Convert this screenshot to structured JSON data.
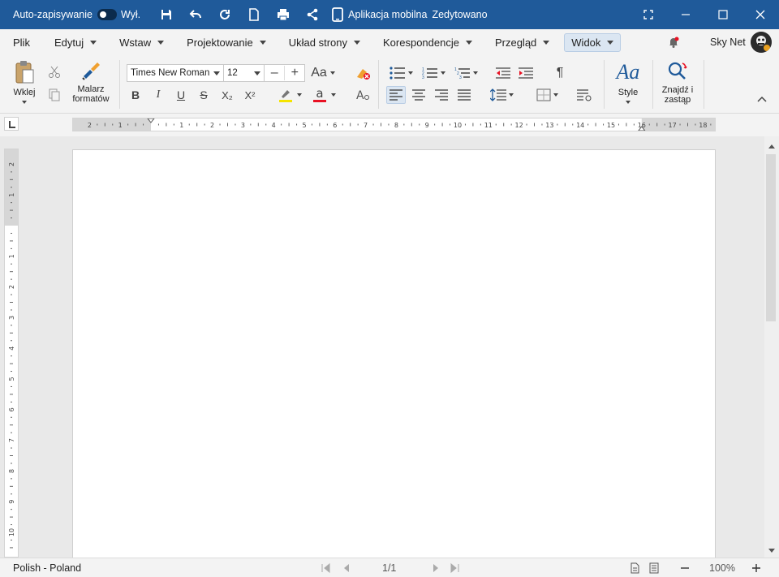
{
  "titlebar": {
    "autosave_label": "Auto-zapisywanie",
    "autosave_state": "Wył.",
    "mobile_label": "Aplikacja mobilna",
    "edited_label": "Zedytowano"
  },
  "menu": {
    "items": [
      {
        "label": "Plik"
      },
      {
        "label": "Edytuj"
      },
      {
        "label": "Wstaw"
      },
      {
        "label": "Projektowanie"
      },
      {
        "label": "Układ strony"
      },
      {
        "label": "Korespondencje"
      },
      {
        "label": "Przegląd"
      },
      {
        "label": "Widok"
      }
    ],
    "active": "Widok"
  },
  "user": {
    "name": "Sky Net"
  },
  "ribbon": {
    "paste_label": "Wklej",
    "format_painter_label_1": "Malarz",
    "format_painter_label_2": "formatów",
    "font_name": "Times New Roman",
    "font_size": "12",
    "change_case_label": "Aa",
    "styles_label": "Style",
    "find_label_1": "Znajdź i",
    "find_label_2": "zastąp",
    "bold": "B",
    "italic": "I",
    "underline": "U",
    "strike": "S",
    "subscript": "X₂",
    "superscript": "X²",
    "highlight_color": "#f5e400",
    "font_color": "#e81123",
    "font_color_letter": "a",
    "styles_glyph": "Aa",
    "pilcrow": "¶"
  },
  "ruler": {
    "h_ticks": [
      "2",
      "1",
      "",
      "1",
      "2",
      "3",
      "4",
      "5",
      "6",
      "7",
      "8",
      "9",
      "10",
      "11",
      "12",
      "13",
      "14",
      "15",
      "16",
      "17",
      "18"
    ],
    "v_ticks": [
      "2",
      "1",
      "",
      "1",
      "2",
      "3",
      "4",
      "5",
      "6",
      "7",
      "8",
      "9",
      "10"
    ]
  },
  "status": {
    "language": "Polish - Poland",
    "page_info": "1/1",
    "zoom": "100%"
  },
  "colors": {
    "titlebar": "#1f5a9a",
    "accent": "#1f5a9a"
  }
}
